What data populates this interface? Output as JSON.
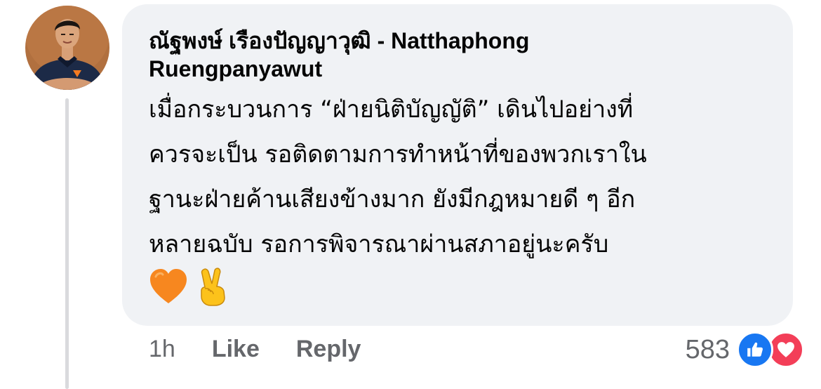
{
  "comment": {
    "author": "ณัฐพงษ์ เรืองปัญญาวุฒิ - Natthaphong Ruengpanyawut",
    "text": "เมื่อกระบวนการ “ฝ่ายนิติบัญญัติ” เดินไปอย่างที่\nควรจะเป็น รอติดตามการทำหน้าที่ของพวกเราใน\nฐานะฝ่ายค้านเสียงข้างมาก ยังมีกฎหมายดี ๆ อีก\nหลายฉบับ รอการพิจารณาผ่านสภาอยู่นะครับ",
    "emojis": [
      "orange-heart",
      "victory-hand"
    ],
    "time": "1h",
    "like_label": "Like",
    "reply_label": "Reply",
    "reaction_count": "583",
    "reactions": [
      "like",
      "love"
    ]
  },
  "colors": {
    "bubble": "#f0f2f5",
    "like_blue": "#1877f2",
    "love_red": "#f33e58",
    "secondary_text": "#65676b"
  }
}
